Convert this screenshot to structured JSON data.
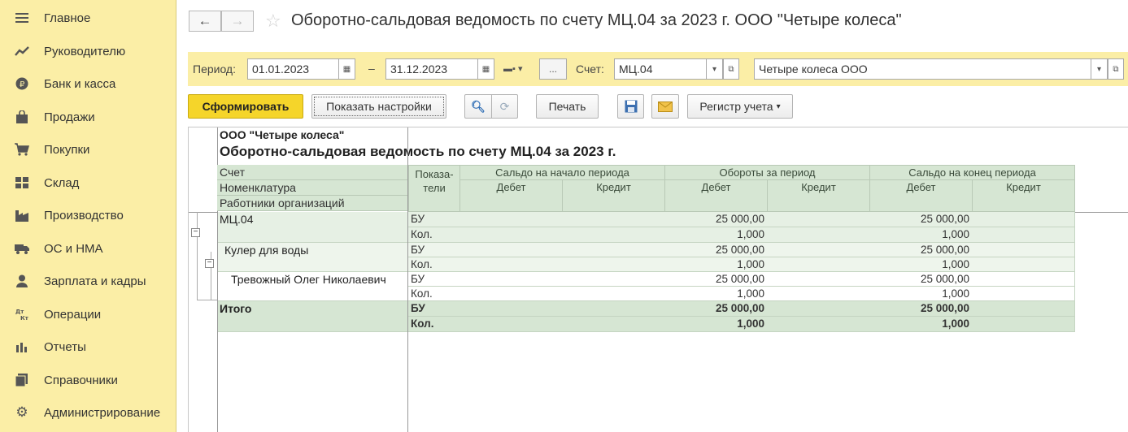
{
  "sidebar": {
    "items": [
      {
        "label": "Главное",
        "icon": "menu-icon"
      },
      {
        "label": "Руководителю",
        "icon": "trend-icon"
      },
      {
        "label": "Банк и касса",
        "icon": "coin-icon"
      },
      {
        "label": "Продажи",
        "icon": "bag-icon"
      },
      {
        "label": "Покупки",
        "icon": "cart-icon"
      },
      {
        "label": "Склад",
        "icon": "warehouse-icon"
      },
      {
        "label": "Производство",
        "icon": "factory-icon"
      },
      {
        "label": "ОС и НМА",
        "icon": "truck-icon"
      },
      {
        "label": "Зарплата и кадры",
        "icon": "person-icon"
      },
      {
        "label": "Операции",
        "icon": "dt-kt-icon"
      },
      {
        "label": "Отчеты",
        "icon": "bar-chart-icon"
      },
      {
        "label": "Справочники",
        "icon": "books-icon"
      },
      {
        "label": "Администрирование",
        "icon": "gear-icon"
      }
    ]
  },
  "header": {
    "title": "Оборотно-сальдовая ведомость по счету МЦ.04 за 2023 г. ООО \"Четыре колеса\""
  },
  "filters": {
    "period_label": "Период:",
    "date_from": "01.01.2023",
    "dash": "–",
    "date_to": "31.12.2023",
    "ellipsis": "...",
    "account_label": "Счет:",
    "account": "МЦ.04",
    "organization": "Четыре колеса ООО"
  },
  "toolbar": {
    "form_label": "Сформировать",
    "settings_label": "Показать настройки",
    "print_label": "Печать",
    "register_label": "Регистр учета"
  },
  "report": {
    "company": "ООО \"Четыре колеса\"",
    "title": "Оборотно-сальдовая ведомость по счету МЦ.04 за 2023 г.",
    "left_headers": [
      "Счет",
      "Номенклатура",
      "Работники организаций"
    ],
    "col_indicators": "Показа-\nтели",
    "groups": [
      "Сальдо на начало периода",
      "Обороты за период",
      "Сальдо на конец периода"
    ],
    "debit": "Дебет",
    "credit": "Кредит",
    "rows": [
      {
        "name": "МЦ.04",
        "ind": "БУ",
        "od": "25 000,00",
        "ed": "25 000,00"
      },
      {
        "name": "",
        "ind": "Кол.",
        "od": "1,000",
        "ed": "1,000"
      },
      {
        "name": "Кулер для воды",
        "ind": "БУ",
        "od": "25 000,00",
        "ed": "25 000,00"
      },
      {
        "name": "",
        "ind": "Кол.",
        "od": "1,000",
        "ed": "1,000"
      },
      {
        "name": "Тревожный Олег Николаевич",
        "ind": "БУ",
        "od": "25 000,00",
        "ed": "25 000,00"
      },
      {
        "name": "",
        "ind": "Кол.",
        "od": "1,000",
        "ed": "1,000"
      },
      {
        "name": "Итого",
        "ind": "БУ",
        "od": "25 000,00",
        "ed": "25 000,00"
      },
      {
        "name": "",
        "ind": "Кол.",
        "od": "1,000",
        "ed": "1,000"
      }
    ]
  }
}
